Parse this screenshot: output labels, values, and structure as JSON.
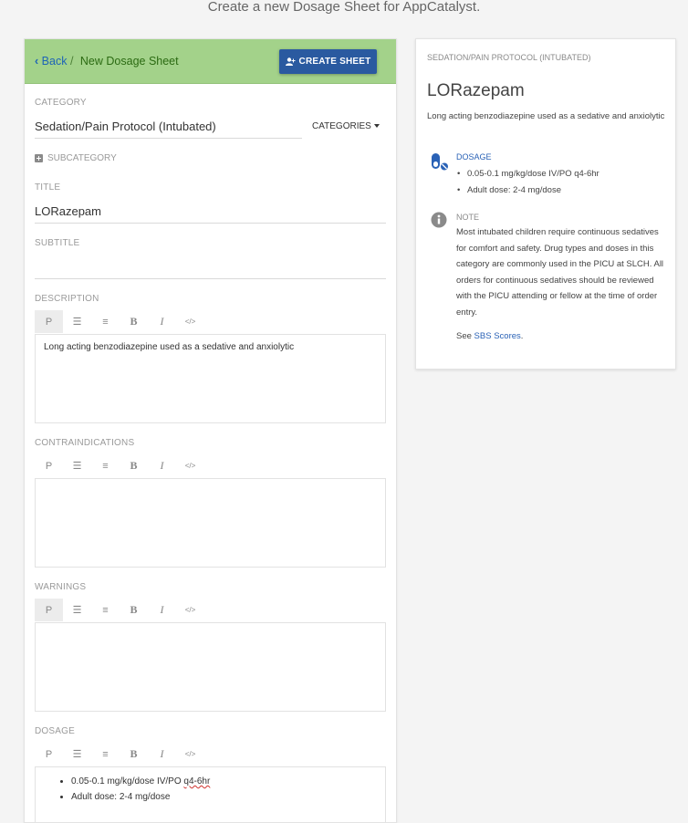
{
  "page": {
    "heading": "Create a new Dosage Sheet for AppCatalyst."
  },
  "header": {
    "back_label": "Back",
    "separator": "/",
    "current_label": "New Dosage Sheet",
    "create_label": "CREATE SHEET"
  },
  "form": {
    "category_label": "CATEGORY",
    "category_value": "Sedation/Pain Protocol (Intubated)",
    "categories_dropdown": "CATEGORIES",
    "subcategory_label": "SUBCATEGORY",
    "title_label": "TITLE",
    "title_value": "LORazepam",
    "subtitle_label": "SUBTITLE",
    "subtitle_value": "",
    "description_label": "DESCRIPTION",
    "description_text": "Long acting benzodiazepine used as a sedative and anxiolytic",
    "contraindications_label": "CONTRAINDICATIONS",
    "contraindications_text": "",
    "warnings_label": "WARNINGS",
    "warnings_text": "",
    "dosage_label": "DOSAGE",
    "dosage_items": [
      {
        "before": "0.05-0.1 mg/kg/dose IV/PO ",
        "spell": "q4-6hr"
      },
      {
        "before": "Adult dose: 2-4 mg/dose",
        "spell": ""
      }
    ]
  },
  "toolbar": {
    "p": "P",
    "bold": "B",
    "italic": "I",
    "code": "</>"
  },
  "preview": {
    "category": "SEDATION/PAIN PROTOCOL (INTUBATED)",
    "title": "LORazepam",
    "description": "Long acting benzodiazepine used as a sedative and anxiolytic",
    "dosage_label": "DOSAGE",
    "dosage_items": [
      "0.05-0.1 mg/kg/dose IV/PO q4-6hr",
      "Adult dose: 2-4 mg/dose"
    ],
    "note_label": "NOTE",
    "note_text": "Most intubated children require continuous sedatives for comfort and safety. Drug types and doses in this category are commonly used in the PICU at SLCH. All orders for continuous sedatives should be reviewed with the PICU attending or fellow at the time of order entry.",
    "see_prefix": "See ",
    "see_link": "SBS Scores",
    "see_suffix": "."
  },
  "colors": {
    "header_bg": "#a3d28a",
    "primary_button": "#2a5aa0",
    "link": "#2a62b6",
    "breadcrumb_text": "#2b6a12"
  }
}
